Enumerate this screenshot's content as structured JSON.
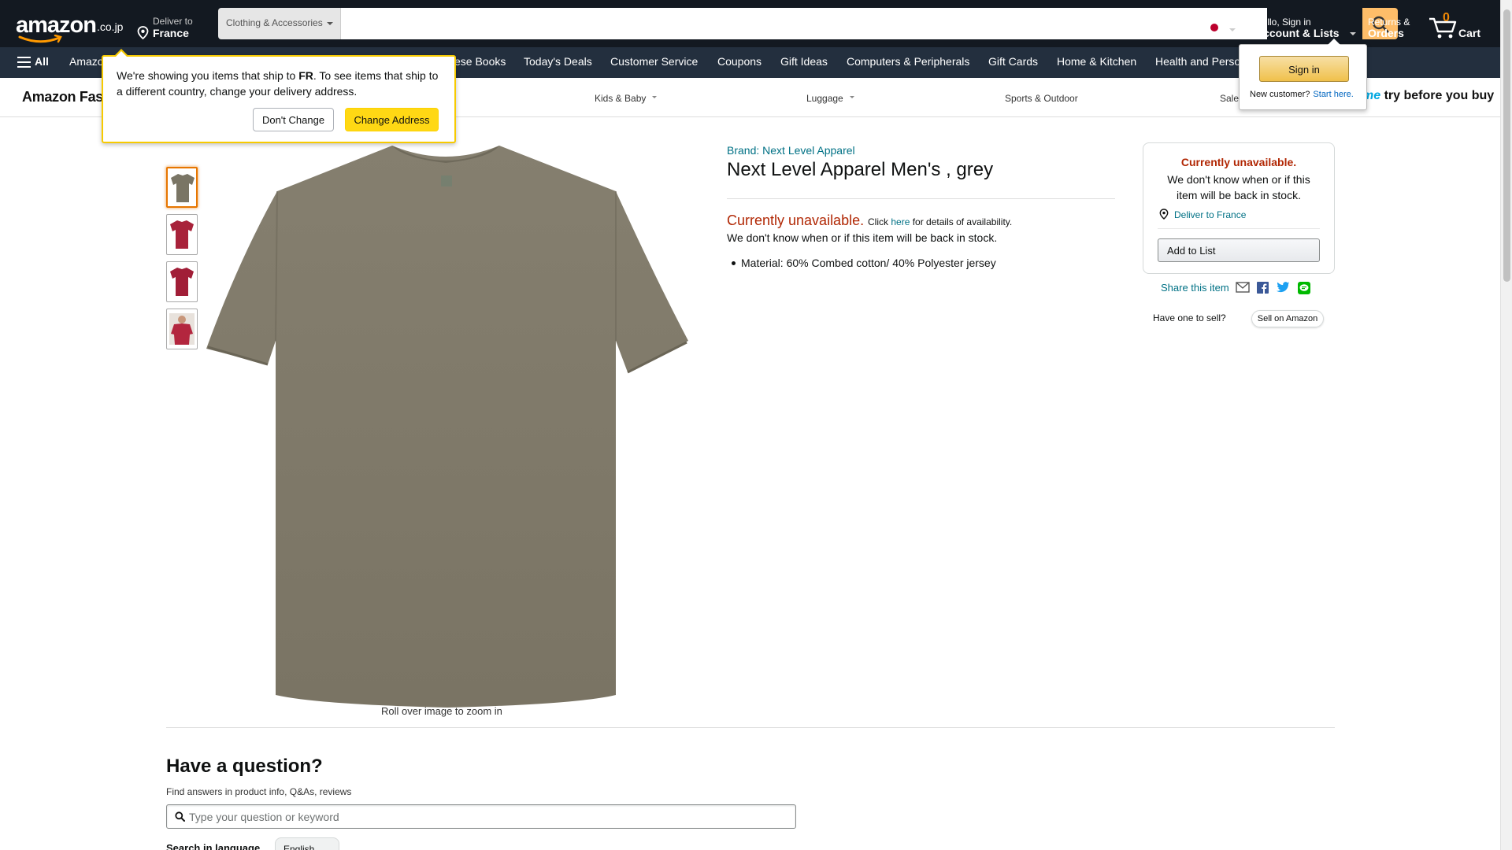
{
  "header": {
    "logo_text": "amazon",
    "logo_tld": ".co.jp",
    "deliver_line1": "Deliver to",
    "deliver_line2": "France",
    "search_category": "Clothing & Accessories",
    "search_placeholder": "",
    "account_line1": "Hello, Sign in",
    "account_line2": "Account & Lists",
    "returns_line1": "Returns &",
    "returns_line2": "Orders",
    "cart_count": "0",
    "cart_label": "Cart",
    "accent_color": "#febd69"
  },
  "nav": {
    "all_label": "All",
    "items": [
      "Amazon",
      "Japanese Books",
      "Today's Deals",
      "Customer Service",
      "Coupons",
      "Gift Ideas",
      "Computers & Peripherals",
      "Gift Cards",
      "Home & Kitchen",
      "Health and Perso"
    ],
    "visible_item_prefixes": [
      "Amazo",
      "ese Books"
    ]
  },
  "subnav": {
    "store_name": "Amazon Fas",
    "categories": [
      "Kids & Baby",
      "Luggage",
      "Sports & Outdoor",
      "Sale"
    ],
    "promo_prefix": "me",
    "promo_text": "try before you buy"
  },
  "product": {
    "brand_link": "Brand: Next Level Apparel",
    "title": "Next Level Apparel Men's , grey",
    "unavailable_heading": "Currently unavailable.",
    "click_text": "Click",
    "here_link": "here",
    "availability_suffix": "for details of availability.",
    "stock_message": "We don't know when or if this item will be back in stock.",
    "bullets": [
      "Material: 60% Combed cotton/ 40% Polyester jersey"
    ],
    "rollover_text": "Roll over image to zoom in",
    "thumbnails": [
      "grey tee",
      "red tee",
      "red tee",
      "model red tee"
    ]
  },
  "buybox": {
    "heading": "Currently unavailable.",
    "message": "We don't know when or if this item will be back in stock.",
    "deliver_link": "Deliver to France",
    "add_to_list": "Add to List"
  },
  "share": {
    "label": "Share this item",
    "icons": [
      "email-icon",
      "facebook-icon",
      "twitter-icon",
      "line-icon"
    ]
  },
  "sell": {
    "question": "Have one to sell?",
    "button": "Sell on Amazon"
  },
  "qa": {
    "title": "Have a question?",
    "subtitle": "Find answers in product info, Q&As, reviews",
    "placeholder": "Type your question or keyword",
    "language_label": "Search in language",
    "language_value": "English"
  },
  "ship_popover": {
    "message_part1": "We're showing you items that ship to ",
    "country": "FR",
    "message_part2": ". To see items that ship to a different country, change your delivery address.",
    "dont_change": "Don't Change",
    "change_address": "Change Address"
  },
  "signin_popover": {
    "signin_button": "Sign in",
    "new_customer": "New customer?",
    "start_here": "Start here."
  }
}
